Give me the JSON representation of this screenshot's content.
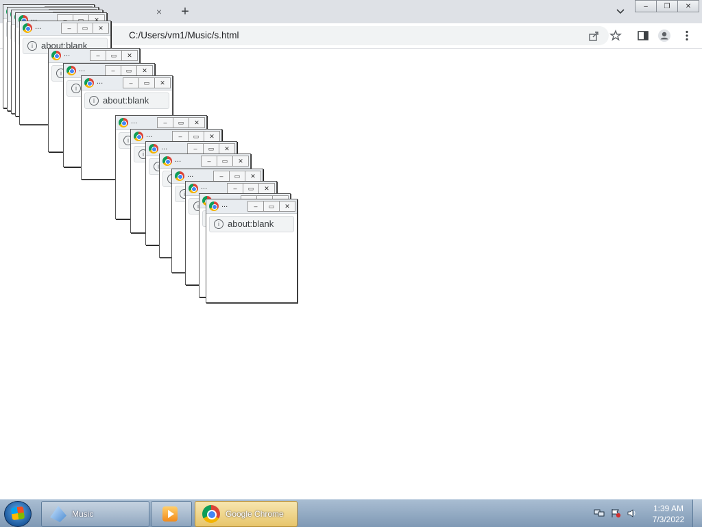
{
  "browser": {
    "url": "C:/Users/vm1/Music/s.html",
    "tab_close_symbol": "×",
    "new_tab_symbol": "+",
    "window_buttons": [
      "–",
      "❐",
      "✕"
    ]
  },
  "popups": {
    "title_ellipsis": "...",
    "address_text": "about:blank",
    "info_symbol": "i",
    "buttons": [
      "–",
      "▭",
      "✕"
    ]
  },
  "taskbar": {
    "items": [
      {
        "label": "Music",
        "icon": "music-library-icon"
      },
      {
        "label": "",
        "icon": "media-player-icon"
      },
      {
        "label": "Google Chrome",
        "icon": "chrome-icon"
      }
    ],
    "clock_time": "1:39 AM",
    "clock_date": "7/3/2022"
  }
}
